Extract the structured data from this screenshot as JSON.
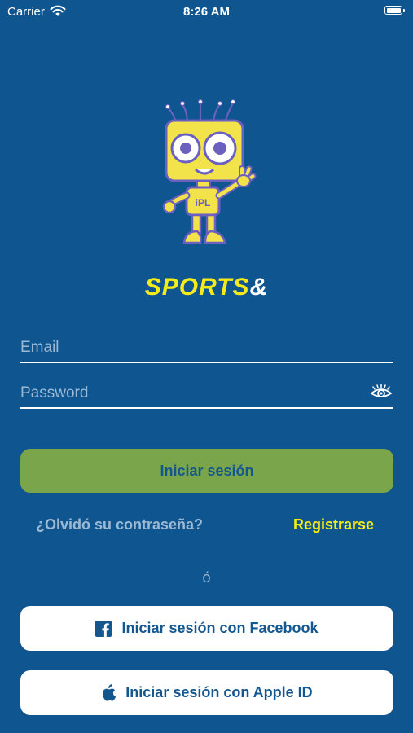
{
  "status_bar": {
    "carrier": "Carrier",
    "time": "8:26 AM"
  },
  "brand": {
    "word": "SPORTS",
    "symbol": "&",
    "mascot_badge": "iPL"
  },
  "form": {
    "email_placeholder": "Email",
    "password_placeholder": "Password",
    "login_label": "Iniciar sesión",
    "forgot_label": "¿Olvidó su contraseña?",
    "register_label": "Registrarse",
    "or_label": "ó",
    "facebook_label": "Iniciar sesión con Facebook",
    "apple_label": "Iniciar sesión con Apple ID"
  },
  "icons": {
    "wifi": "wifi-icon",
    "battery": "battery-icon",
    "show_password": "eye-icon",
    "facebook": "facebook-icon",
    "apple": "apple-icon"
  },
  "colors": {
    "background": "#0f5590",
    "accent_yellow": "#f5ea1a",
    "login_button": "#7aa54b",
    "muted_text": "#9cb9d4",
    "social_button": "#ffffff",
    "button_text": "#14578f"
  }
}
